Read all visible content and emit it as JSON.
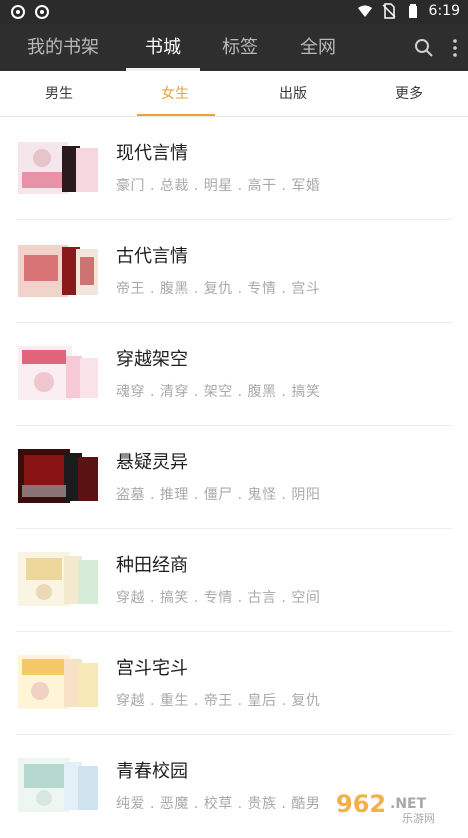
{
  "statusbar": {
    "time": "6:19"
  },
  "topbar": {
    "tabs": [
      "我的书架",
      "书城",
      "标签",
      "全网"
    ],
    "active_tab": 1
  },
  "subtabs": {
    "items": [
      "男生",
      "女生",
      "出版",
      "更多"
    ],
    "active": 1,
    "accent": "#e8a33c"
  },
  "categories": [
    {
      "title": "现代言情",
      "tags": "豪门 . 总裁 . 明星 . 高干 . 军婚"
    },
    {
      "title": "古代言情",
      "tags": "帝王 . 腹黑 . 复仇 . 专情 . 宫斗"
    },
    {
      "title": "穿越架空",
      "tags": "魂穿 . 清穿 . 架空 . 腹黑 . 搞笑"
    },
    {
      "title": "悬疑灵异",
      "tags": "盗墓 . 推理 . 僵尸 . 鬼怪 . 阴阳"
    },
    {
      "title": "种田经商",
      "tags": "穿越 . 搞笑 . 专情 . 古言 . 空间"
    },
    {
      "title": "宫斗宅斗",
      "tags": "穿越 . 重生 . 帝王 . 皇后 . 复仇"
    },
    {
      "title": "青春校园",
      "tags": "纯爱 . 恶魔 . 校草 . 贵族 . 酷男"
    }
  ],
  "watermark": {
    "number": "962",
    "suffix": ".NET",
    "site": "乐游网"
  }
}
